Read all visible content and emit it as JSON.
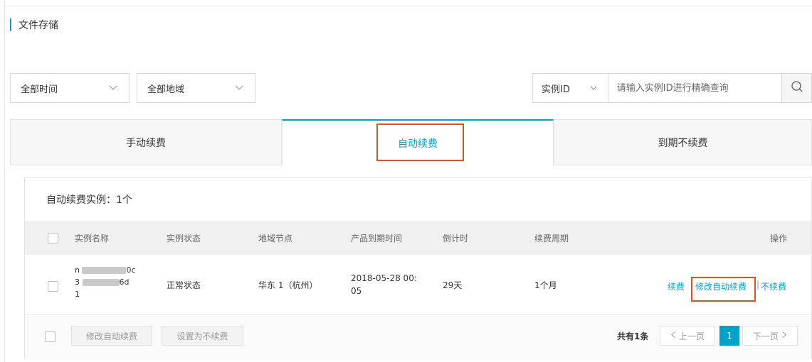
{
  "page": {
    "title": "文件存储"
  },
  "filters": {
    "time": {
      "selected": "全部时间"
    },
    "region": {
      "selected": "全部地域"
    },
    "search": {
      "type": "实例ID",
      "placeholder": "请输入实例ID进行精确查询"
    }
  },
  "tabs": [
    {
      "label": "手动续费",
      "active": false
    },
    {
      "label": "自动续费",
      "active": true
    },
    {
      "label": "到期不续费",
      "active": false
    }
  ],
  "panel": {
    "count_label": "自动续费实例：1个",
    "columns": {
      "name": "实例名称",
      "status": "实例状态",
      "region": "地域节点",
      "expire": "产品到期时间",
      "countdown": "倒计时",
      "period": "续费周期",
      "ops": "操作"
    },
    "rows": [
      {
        "name_lines": [
          "n",
          "0c",
          "3",
          "6d",
          "1"
        ],
        "status": "正常状态",
        "region": "华东 1（杭州）",
        "expire_line1": "2018-05-28 00:",
        "expire_line2": "05",
        "countdown": "29天",
        "period": "1个月",
        "ops": {
          "renew": "续费",
          "modify": "修改自动续费",
          "sep": "|",
          "no_renew": "不续费"
        }
      }
    ],
    "footer": {
      "btn_modify": "修改自动续费",
      "btn_set_no_renew": "设置为不续费",
      "total": "共有1条",
      "prev": "上一页",
      "current_page": "1",
      "next": "下一页"
    }
  },
  "colors": {
    "accent": "#00a2ca",
    "highlight": "#e44d26",
    "title_bar": "#2b8ccd"
  },
  "icons": {
    "select_arrow": "chevron-down-icon",
    "search": "search-icon",
    "prev": "chevron-left-icon",
    "next": "chevron-right-icon"
  }
}
